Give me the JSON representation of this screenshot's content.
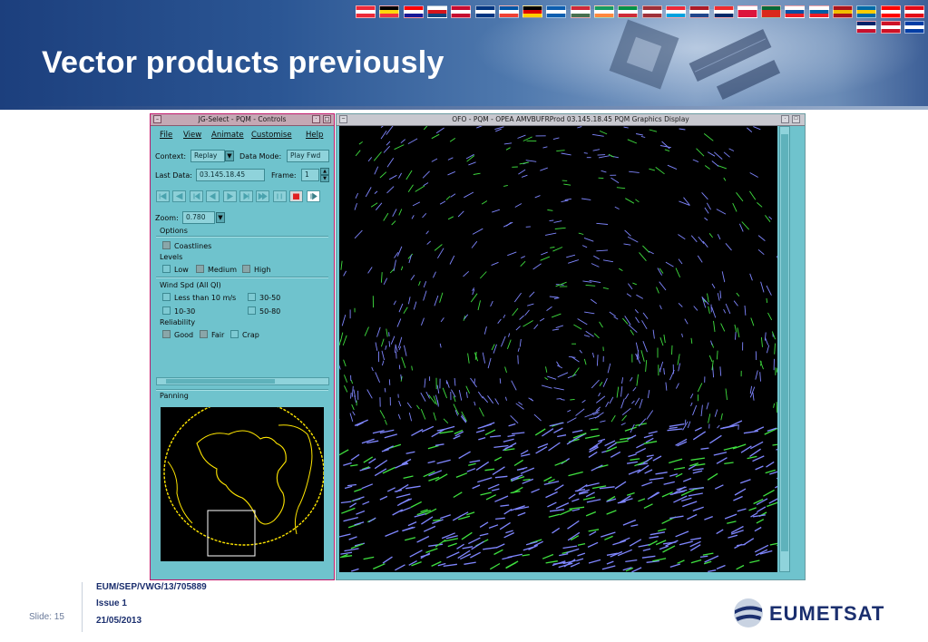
{
  "slide": {
    "title": "Vector products previously",
    "footer_doc": "EUM/SEP/VWG/13/705889",
    "footer_issue": "Issue 1",
    "footer_date": "21/05/2013",
    "slide_label": "Slide: 15",
    "logo_text": "EUMETSAT"
  },
  "colors": {
    "banner_dark": "#1c3f7d",
    "title_text": "#ffffff",
    "panel_bg": "#6fc3cd",
    "panel_border": "#c2186b",
    "vector_blue": "#7f86ff",
    "vector_green": "#3fe03f",
    "coastline": "#ffe600",
    "footer_text": "#1b2f6e"
  },
  "controls_window": {
    "title": "JG-Select - PQM - Controls",
    "menu": [
      "File",
      "View",
      "Animate",
      "Customise",
      "Help"
    ],
    "context_label": "Context:",
    "context_value": "Replay",
    "data_mode_label": "Data Mode:",
    "data_mode_value": "Play Fwd",
    "last_data_label": "Last Data:",
    "last_data_value": "03.145.18.45",
    "frame_label": "Frame:",
    "frame_value": "1",
    "zoom_label": "Zoom:",
    "zoom_value": "0.780",
    "playback_buttons": [
      "first-frame",
      "rewind",
      "step-back",
      "play-backward",
      "play-forward",
      "step-forward",
      "fast-forward",
      "pause",
      "stop",
      "loop"
    ],
    "options_title": "Options",
    "coastlines_label": "Coastlines",
    "levels_label": "Levels",
    "level_low": "Low",
    "level_medium": "Medium",
    "level_high": "High",
    "wind_title": "Wind Spd (All QI)",
    "wind_lt10": "Less than 10 m/s",
    "wind_30_50": "30-50",
    "wind_10_30": "10-30",
    "wind_50_80": "50-80",
    "reliability_label": "Reliability",
    "rel_good": "Good",
    "rel_fair": "Fair",
    "rel_crap": "Crap",
    "panning_title": "Panning"
  },
  "graphics_window": {
    "title": "OFO - PQM - OPEA AMVBUFRProd 03.145.18.45 PQM Graphics Display"
  }
}
